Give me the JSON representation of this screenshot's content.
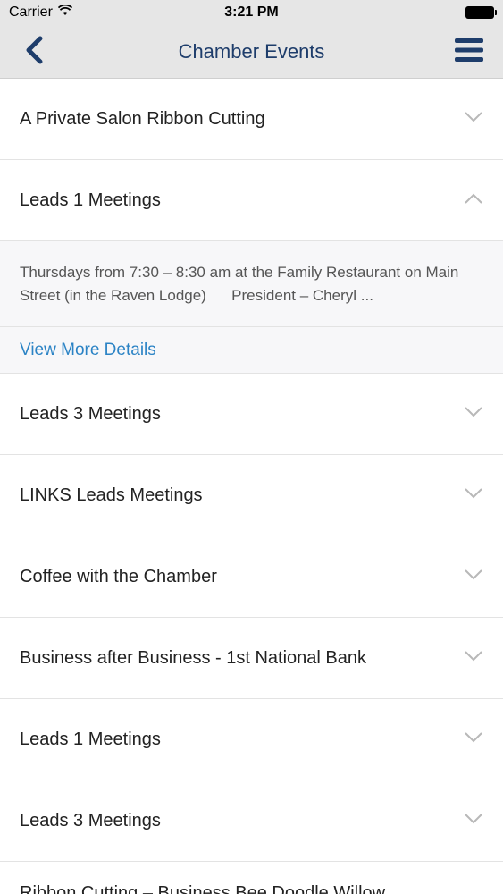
{
  "status": {
    "carrier": "Carrier",
    "time": "3:21 PM"
  },
  "nav": {
    "title": "Chamber Events"
  },
  "events": [
    {
      "label": "A Private Salon Ribbon Cutting"
    },
    {
      "label": "Leads 1 Meetings"
    },
    {
      "label": "Leads 3 Meetings"
    },
    {
      "label": "LINKS Leads Meetings"
    },
    {
      "label": "Coffee with the Chamber"
    },
    {
      "label": "Business after Business - 1st National Bank"
    },
    {
      "label": "Leads 1 Meetings"
    },
    {
      "label": "Leads 3 Meetings"
    }
  ],
  "expanded": {
    "description": "Thursdays from 7:30 – 8:30 am at the Family Restaurant on Main Street (in the Raven Lodge)      President – Cheryl ...",
    "link_label": "View More Details"
  },
  "partial_row": {
    "label": "Ribbon Cutting – Business Bee Doodle Willow"
  }
}
